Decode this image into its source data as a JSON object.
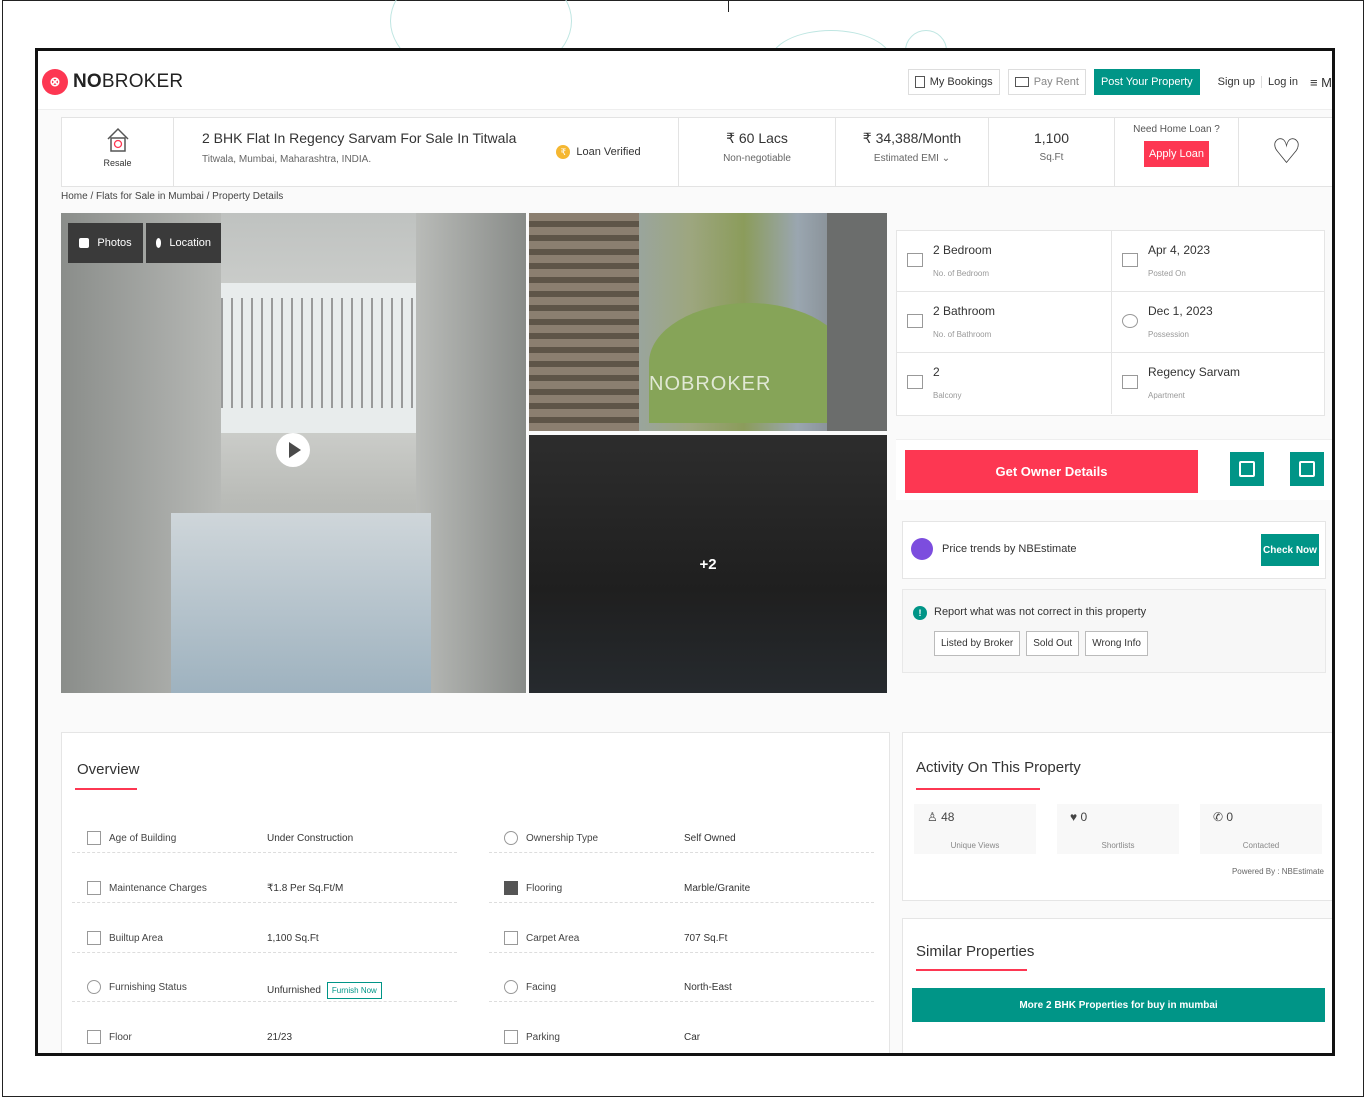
{
  "header": {
    "logo_mark": "⊗",
    "logo_bold": "NO",
    "logo_rest": "BROKER",
    "my_bookings": "My Bookings",
    "pay_rent": "Pay Rent",
    "post_property": "Post Your Property",
    "sign_up": "Sign up",
    "log_in": "Log in",
    "menu": "≡ M"
  },
  "summary": {
    "resale_label": "Resale",
    "title": "2 BHK Flat In Regency Sarvam For Sale In Titwala",
    "address": "Titwala, Mumbai, Maharashtra, INDIA.",
    "loan_verified": "Loan Verified",
    "price": "₹ 60 Lacs",
    "price_note": "Non-negotiable",
    "emi": "₹ 34,388/Month",
    "emi_label": "Estimated EMI ⌄",
    "area": "1,100",
    "area_unit": "Sq.Ft",
    "need_loan": "Need Home Loan ?",
    "apply_loan": "Apply Loan",
    "heart": "♡"
  },
  "breadcrumb": "Home / Flats for Sale in Mumbai / Property Details",
  "gallery": {
    "photos_tag": "Photos",
    "location_tag": "Location",
    "watermark": "NOBROKER",
    "more_count": "+2"
  },
  "attributes": [
    {
      "value": "2 Bedroom",
      "label": "No. of Bedroom",
      "icon": "bed-icon"
    },
    {
      "value": "Apr 4, 2023",
      "label": "Posted On",
      "icon": "calendar-icon"
    },
    {
      "value": "2 Bathroom",
      "label": "No. of Bathroom",
      "icon": "bathtub-icon"
    },
    {
      "value": "Dec 1, 2023",
      "label": "Possession",
      "icon": "key-icon"
    },
    {
      "value": "2",
      "label": "Balcony",
      "icon": "balcony-icon"
    },
    {
      "value": "Regency Sarvam",
      "label": "Apartment",
      "icon": "building-icon"
    }
  ],
  "actions": {
    "get_owner_details": "Get Owner Details",
    "price_trends": "Price trends by NBEstimate",
    "check_now": "Check Now",
    "report_text": "Report what was not correct in this property",
    "report_buttons": [
      "Listed by Broker",
      "Sold Out",
      "Wrong Info"
    ]
  },
  "overview": {
    "title": "Overview",
    "furnish_now": "Furnish Now",
    "rows": [
      {
        "label": "Age of Building",
        "value": "Under Construction",
        "icon": "building-age-icon"
      },
      {
        "label": "Ownership Type",
        "value": "Self Owned",
        "icon": "ownership-icon"
      },
      {
        "label": "Maintenance Charges",
        "value": "₹1.8 Per Sq.Ft/M",
        "icon": "maintenance-icon"
      },
      {
        "label": "Flooring",
        "value": "Marble/Granite",
        "icon": "flooring-icon"
      },
      {
        "label": "Builtup Area",
        "value": "1,100 Sq.Ft",
        "icon": "builtup-icon"
      },
      {
        "label": "Carpet Area",
        "value": "707 Sq.Ft",
        "icon": "carpet-area-icon"
      },
      {
        "label": "Furnishing Status",
        "value": "Unfurnished",
        "icon": "sofa-icon"
      },
      {
        "label": "Facing",
        "value": "North-East",
        "icon": "compass-icon"
      },
      {
        "label": "Floor",
        "value": "21/23",
        "icon": "floor-icon"
      },
      {
        "label": "Parking",
        "value": "Car",
        "icon": "car-icon"
      }
    ]
  },
  "activity": {
    "title": "Activity On This Property",
    "stats": [
      {
        "num": "♙ 48",
        "label": "Unique Views"
      },
      {
        "num": "♥ 0",
        "label": "Shortlists"
      },
      {
        "num": "✆ 0",
        "label": "Contacted"
      }
    ],
    "powered_by": "Powered By : NBEstimate"
  },
  "similar": {
    "title": "Similar Properties",
    "button": "More 2 BHK Properties for buy in mumbai"
  },
  "colors": {
    "brand_red": "#fd3752",
    "brand_teal": "#009587"
  }
}
